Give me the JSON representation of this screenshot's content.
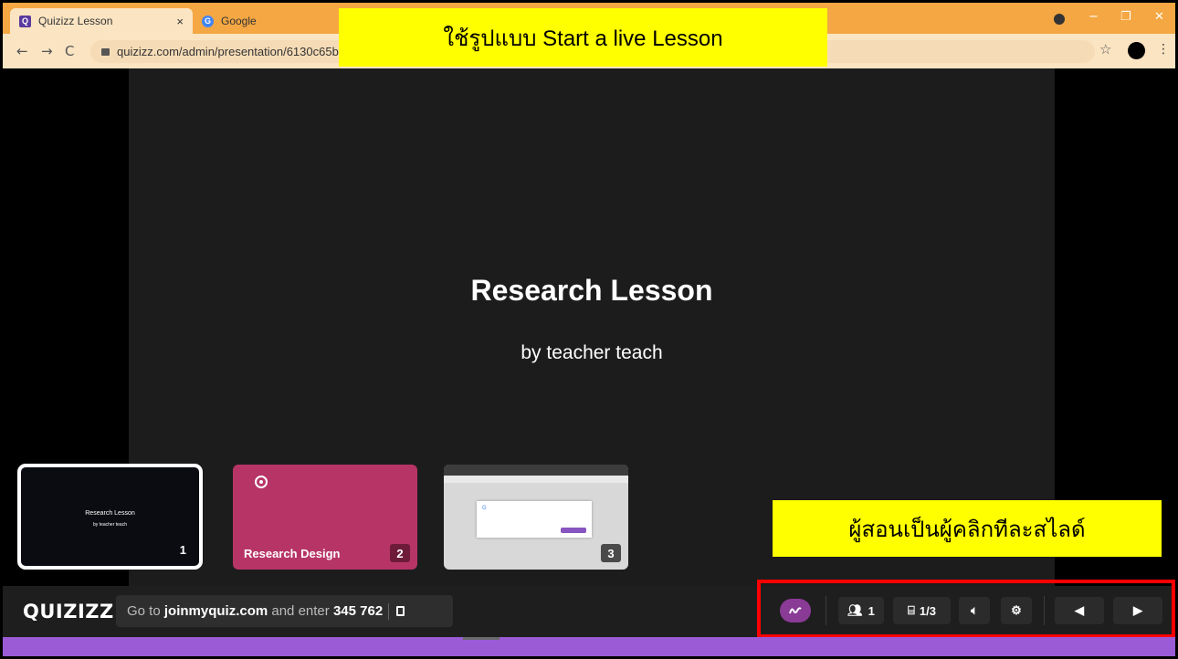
{
  "browser": {
    "tabs": [
      {
        "label": "Quizizz Lesson",
        "active": true,
        "favicon_color": "#5b3a9e"
      },
      {
        "label": "Google",
        "active": false,
        "favicon_color": "#4285f4"
      }
    ],
    "url": "quizizz.com/admin/presentation/6130c65b801c"
  },
  "annotations": {
    "top": "ใช้รูปแบบ Start a live Lesson",
    "right": "ผู้สอนเป็นผู้คลิกทีละสไลด์"
  },
  "slide": {
    "title": "Research Lesson",
    "subtitle": "by teacher teach"
  },
  "thumbnails": [
    {
      "title": "Research Lesson",
      "subtitle": "by teacher teach",
      "number": "1",
      "selected": true
    },
    {
      "title": "Research Design",
      "number": "2",
      "color": "#b73466"
    },
    {
      "number": "3"
    }
  ],
  "toolbar": {
    "brand": "QUIZIZZ",
    "join_prefix": "Go to",
    "join_site": "joinmyquiz.com",
    "join_mid": "and enter",
    "join_code": "345 762",
    "participants": "1",
    "slide_counter": "1/3"
  },
  "colors": {
    "accent_purple": "#9c5bd6",
    "pen_button": "#8a3b96",
    "highlight_red": "#ff0000",
    "callout_yellow": "#ffff00"
  }
}
